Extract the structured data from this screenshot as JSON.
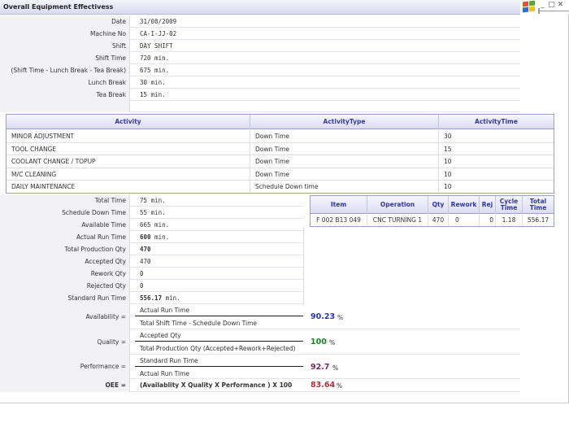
{
  "window": {
    "title": "Overall Equipment Effectivess",
    "controls": [
      "_",
      "□",
      "✕"
    ]
  },
  "header_fields": [
    {
      "label": "Date",
      "value": "31/08/2009"
    },
    {
      "label": "Machine No",
      "value": "CA-I-JJ-02"
    },
    {
      "label": "Shift",
      "value": "DAY SHIFT"
    },
    {
      "label": "Shift Time",
      "value": "720 min."
    },
    {
      "label": "(Shift Time - Lunch Break - Tea Break)",
      "value": "675 min."
    },
    {
      "label": "Lunch Break",
      "value": "30 min."
    },
    {
      "label": "Tea Break",
      "value": "15 min."
    }
  ],
  "activity_table": {
    "columns": [
      "Activity",
      "ActivityType",
      "ActivityTime"
    ],
    "rows": [
      [
        "MINOR ADJUSTMENT",
        "Down Time",
        "30"
      ],
      [
        "TOOL CHANGE",
        "Down Time",
        "15"
      ],
      [
        "COOLANT CHANGE / TOPUP",
        "Down Time",
        "10"
      ],
      [
        "M/C CLEANING",
        "Down Time",
        "10"
      ],
      [
        "DAILY MAINTENANCE",
        "Schedule Down time",
        "10"
      ]
    ]
  },
  "summary_fields": [
    {
      "label": "Total Time",
      "value": "75 min.",
      "bold": false
    },
    {
      "label": "Schedule Down Time",
      "value": "55 min.",
      "bold": false
    },
    {
      "label": "Available Time",
      "value": "665 min.",
      "bold": false
    },
    {
      "label": "Actual Run Time",
      "value": "600",
      "suffix": " min.",
      "bold": true
    },
    {
      "label": "Total Production Qty",
      "value": "470",
      "bold": true
    },
    {
      "label": "Accepted Qty",
      "value": "470",
      "bold": false
    },
    {
      "label": "Rework Qty",
      "value": "0",
      "bold": false
    },
    {
      "label": "Rejected Qty",
      "value": "0",
      "bold": false
    },
    {
      "label": "Standard Run Time",
      "value": "556.17",
      "suffix": " min.",
      "bold": true
    }
  ],
  "production_table": {
    "columns": [
      "Item",
      "Operation",
      "Qty",
      "Rework",
      "Rej",
      "Cycle Time",
      "Total Time"
    ],
    "rows": [
      [
        "F 002 B13 049",
        "CNC TURNING 1",
        "470",
        "0",
        "0",
        "1.18",
        "556.17"
      ]
    ]
  },
  "formulas": {
    "availability": {
      "label": "Availability =",
      "numerator": "Actual Run Time",
      "denominator": "Total Shift Time - Schedule Down Time",
      "result": "90.23",
      "unit": "%",
      "color": "#2a35a8"
    },
    "quality": {
      "label": "Quality =",
      "numerator": "Accepted Qty",
      "denominator": "Total Production Qty (Accepted+Rework+Rejected)",
      "result": "100",
      "unit": "%",
      "color": "#1e7d2a"
    },
    "performance": {
      "label": "Performance =",
      "numerator": "Standard Run Time",
      "denominator": "Actual Run Time",
      "result": "92.7",
      "unit": "%",
      "color": "#7d2a6a"
    },
    "oee": {
      "label": "OEE =",
      "expression": "(Availablity X Quality X Performance ) X 100",
      "result": "83.64",
      "unit": "%",
      "color": "#b0303a"
    }
  }
}
